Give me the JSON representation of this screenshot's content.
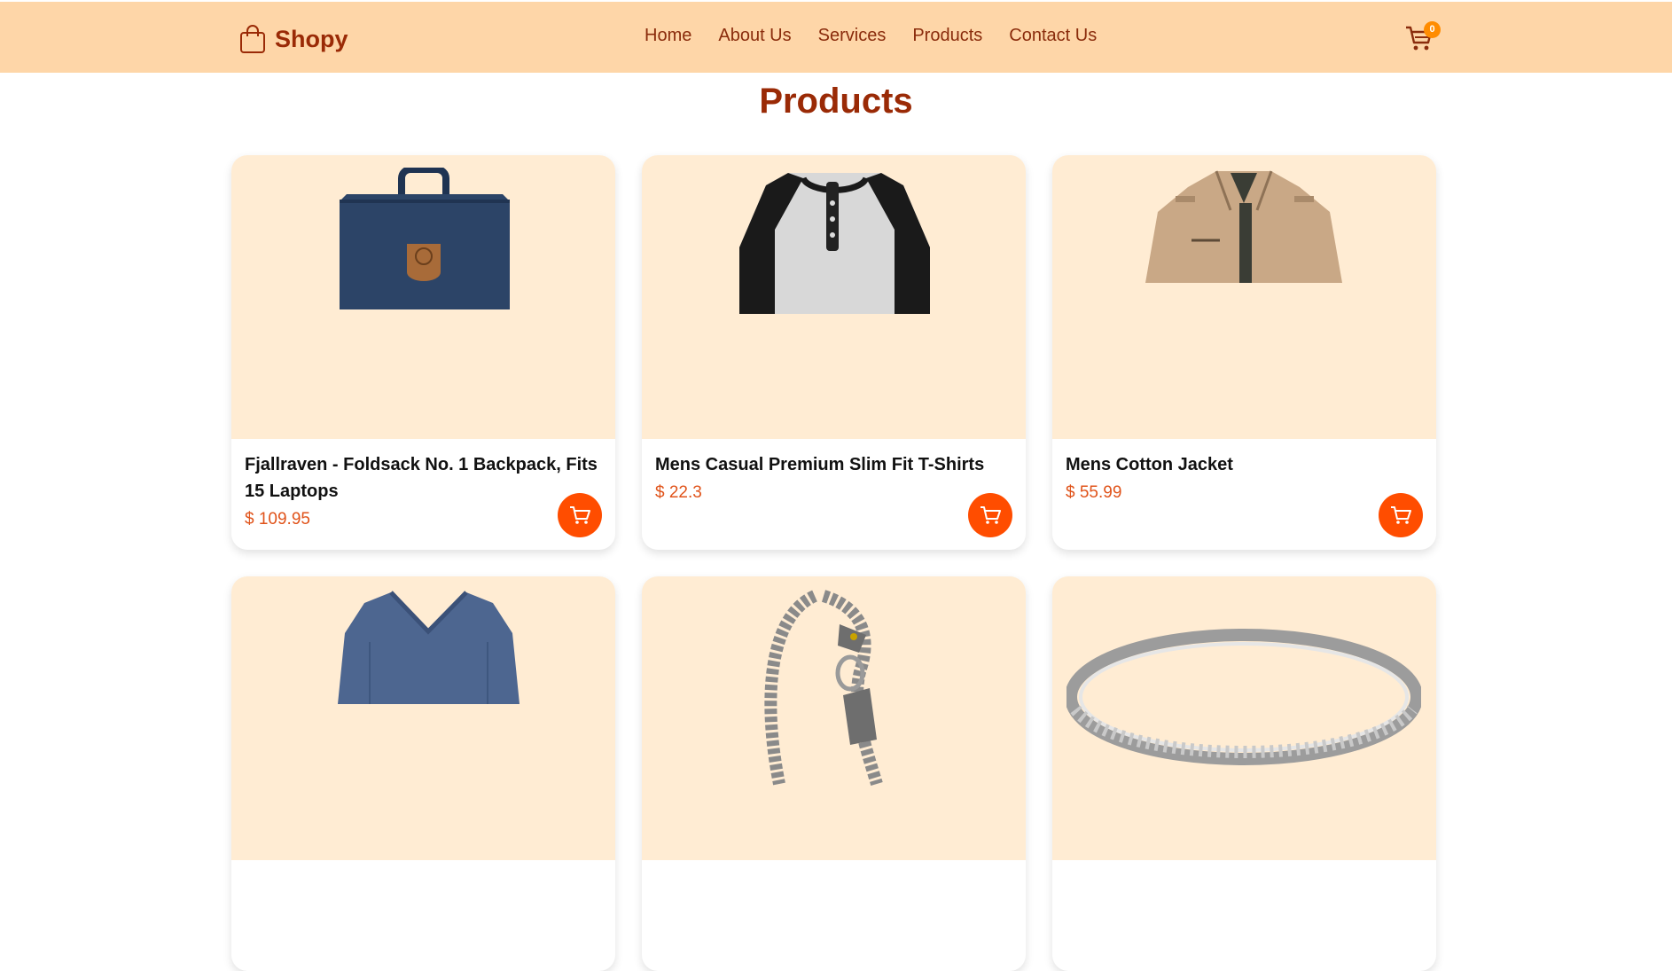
{
  "brand": {
    "name": "Shopy",
    "icon": "shopping-bag-icon"
  },
  "nav": {
    "links": [
      "Home",
      "About Us",
      "Services",
      "Products",
      "Contact Us"
    ]
  },
  "cart": {
    "count": "0",
    "icon": "shopping-cart-icon"
  },
  "page": {
    "title": "Products"
  },
  "colors": {
    "navbar": "#fed6a8",
    "brand_text": "#9a2a06",
    "card_image_bg": "#ffecd3",
    "price": "#e0531a",
    "cart_button": "#ff4d00",
    "badge": "#ff8c00"
  },
  "products": [
    {
      "title": "Fjallraven - Foldsack No. 1 Backpack, Fits 15 Laptops",
      "price": "$ 109.95",
      "image": "navy-backpack-image"
    },
    {
      "title": "Mens Casual Premium Slim Fit T-Shirts",
      "price": "$ 22.3",
      "image": "raglan-henley-tshirt-image"
    },
    {
      "title": "Mens Cotton Jacket",
      "price": "$ 55.99",
      "image": "khaki-cotton-jacket-image"
    },
    {
      "title": "",
      "price": "",
      "image": "blue-vneck-shirt-image"
    },
    {
      "title": "",
      "price": "",
      "image": "dragon-chain-bracelet-image"
    },
    {
      "title": "",
      "price": "",
      "image": "silver-diamond-ring-image"
    }
  ]
}
